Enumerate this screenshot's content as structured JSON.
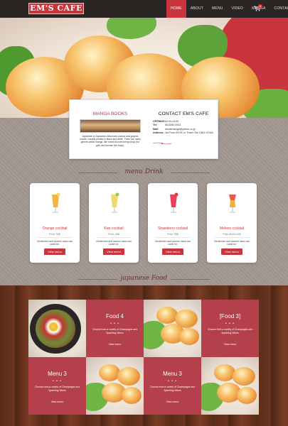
{
  "header": {
    "logo": "EM'S CAFE",
    "nav": [
      "HOME",
      "ABOUT",
      "MENU",
      "VIDEO",
      "MANGA",
      "CONTACT"
    ],
    "active_index": 0,
    "cart_count": "0"
  },
  "info": {
    "manga_title": "MANGA BOOKS",
    "manga_text": "Japanese or Japanese-influenced comics and graphic novels. Usually printed in black-and-white. There are many genres within manga, like mixed shonen being shojo (for girls and shonen (for boys).",
    "contact_title": "CONTACT EM'S CAFE",
    "contact_rows": [
      {
        "k": "OPENING:",
        "v": "10:00-24:00"
      },
      {
        "k": "Tel:",
        "v": "08-8260-9432"
      },
      {
        "k": "Mail:",
        "v": "sfcafemanga@yahoo.co.jp"
      },
      {
        "k": "Address:",
        "v": "3rd Floor 8/Y/H Le Thanh Ton Dist1 HCMC"
      }
    ]
  },
  "sections": {
    "drink_head": "menu Drink",
    "food_head": "japanese Food"
  },
  "drinks": [
    {
      "name": "Orange cocktail",
      "price": "Price: 55$",
      "desc": "Gentlemen and women class can come for.",
      "button": "View menu",
      "color": "#f3b23b"
    },
    {
      "name": "Kiwi cocktail",
      "price": "Price: 55$",
      "desc": "Gentlemen and women class can come for.",
      "button": "View menu",
      "color": "#f0d96b"
    },
    {
      "name": "Strawberry cocktail",
      "price": "Price: 55$",
      "desc": "Gentlemen and women class can come for.",
      "button": "View menu",
      "color": "#e8415a"
    },
    {
      "name": "Melons cocktail",
      "price": "Price:$1000.00$",
      "desc": "Gentlemen and women class can come for.",
      "button": "View menu",
      "color": "#e85a4a"
    }
  ],
  "foods": [
    {
      "name": "Food 4",
      "desc": "Choose from a variety of Champagne and Sparkling Wines",
      "link": "View menu"
    },
    {
      "name": "[Food 3]",
      "desc": "Choose from a variety of Champagne and Sparkling Wines",
      "link": "View menu"
    },
    {
      "name": "Menu 3",
      "desc": "Choose from a variety of Champagne and Sparkling Wines",
      "link": "View menu"
    },
    {
      "name": "Menu 3",
      "desc": "Choose from a variety of Champagne and Sparkling Wines",
      "link": "View menu"
    }
  ],
  "food_dots": "• • •",
  "colors": {
    "accent": "#c8353c",
    "dark": "#2b2523",
    "tile": "#b3404a"
  }
}
